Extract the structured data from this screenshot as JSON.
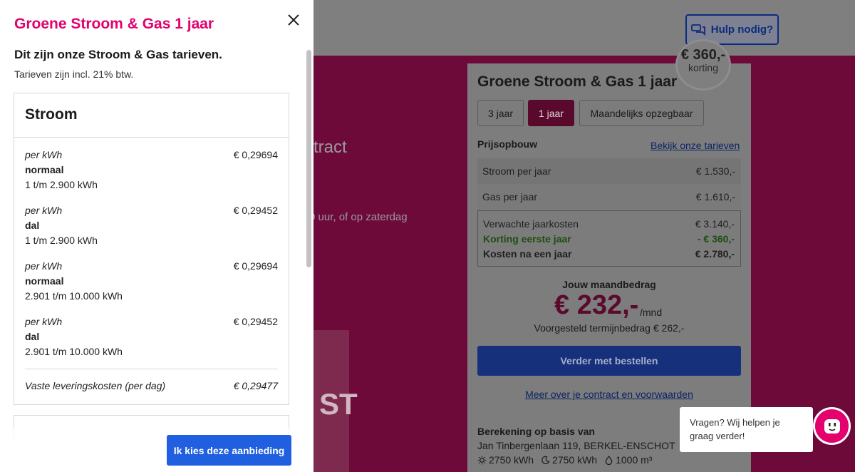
{
  "header": {
    "help_label": "Hulp nodig?"
  },
  "background": {
    "contract_text": "tract",
    "hours_text": "0 uur, of op zaterdag",
    "block_text": "ST"
  },
  "product_card": {
    "badge_amount": "€ 360,-",
    "badge_label": "korting",
    "title": "Groene Stroom & Gas 1 jaar",
    "tabs": [
      {
        "label": "3 jaar",
        "active": false
      },
      {
        "label": "1 jaar",
        "active": true
      },
      {
        "label": "Maandelijks opzegbaar",
        "active": false
      }
    ],
    "prijsopbouw_label": "Prijsopbouw",
    "tarieven_link": "Bekijk onze tarieven",
    "rows": [
      {
        "label": "Stroom per jaar",
        "value": "€ 1.530,-"
      },
      {
        "label": "Gas per jaar",
        "value": "€ 1.610,-"
      }
    ],
    "summary": {
      "expected_label": "Verwachte jaarkosten",
      "expected_value": "€ 3.140,-",
      "discount_label": "Korting eerste jaar",
      "discount_value": "- € 360,-",
      "after_label": "Kosten na een jaar",
      "after_value": "€ 2.780,-"
    },
    "monthly_label": "Jouw maandbedrag",
    "monthly_amount": "€ 232,-",
    "monthly_unit": "/mnd",
    "termijn_text": "Voorgesteld termijnbedrag € 262,-",
    "order_button": "Verder met bestellen",
    "contract_link": "Meer over je contract en voorwaarden",
    "calc_title": "Berekening op basis van",
    "calc_address": "Jan Tinbergenlaan 119, BERKEL-ENSCHOT",
    "usage": {
      "normal": "2750 kWh",
      "low": "2750 kWh",
      "gas": "1000 m³"
    }
  },
  "chat": {
    "text": "Vragen? Wij helpen je graag verder!"
  },
  "panel": {
    "title": "Groene Stroom & Gas 1 jaar",
    "subtitle": "Dit zijn onze Stroom & Gas tarieven.",
    "note": "Tarieven zijn incl. 21% btw.",
    "stroom": {
      "heading": "Stroom",
      "items": [
        {
          "per": "per kWh",
          "kind": "normaal",
          "range": "1 t/m 2.900 kWh",
          "price": "€ 0,29694"
        },
        {
          "per": "per kWh",
          "kind": "dal",
          "range": "1 t/m 2.900 kWh",
          "price": "€ 0,29452"
        },
        {
          "per": "per kWh",
          "kind": "normaal",
          "range": "2.901 t/m 10.000 kWh",
          "price": "€ 0,29694"
        },
        {
          "per": "per kWh",
          "kind": "dal",
          "range": "2.901 t/m 10.000 kWh",
          "price": "€ 0,29452"
        }
      ],
      "vaste_label": "Vaste leveringskosten (per dag)",
      "vaste_price": "€ 0,29477"
    },
    "choose_button": "Ik kies deze aanbieding"
  }
}
